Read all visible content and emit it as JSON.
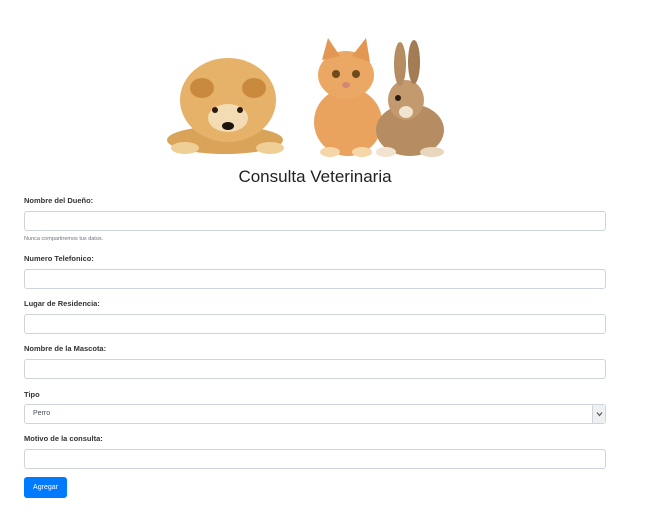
{
  "page": {
    "title": "Consulta Veterinaria",
    "hero_image": "pets-banner-dog-cat-rabbit"
  },
  "form": {
    "owner_label": "Nombre del Dueño:",
    "owner_help": "Nunca compartiremos tus datos.",
    "owner_value": "",
    "phone_label": "Numero Telefonico:",
    "phone_value": "",
    "residence_label": "Lugar de Residencia:",
    "residence_value": "",
    "pet_name_label": "Nombre de la Mascota:",
    "pet_name_value": "",
    "type_label": "Tipo",
    "type_selected": "Perro",
    "reason_label": "Motivo de la consulta:",
    "reason_value": "",
    "submit_label": "Agregar"
  },
  "colors": {
    "primary": "#007bff",
    "border": "#ced4da"
  }
}
